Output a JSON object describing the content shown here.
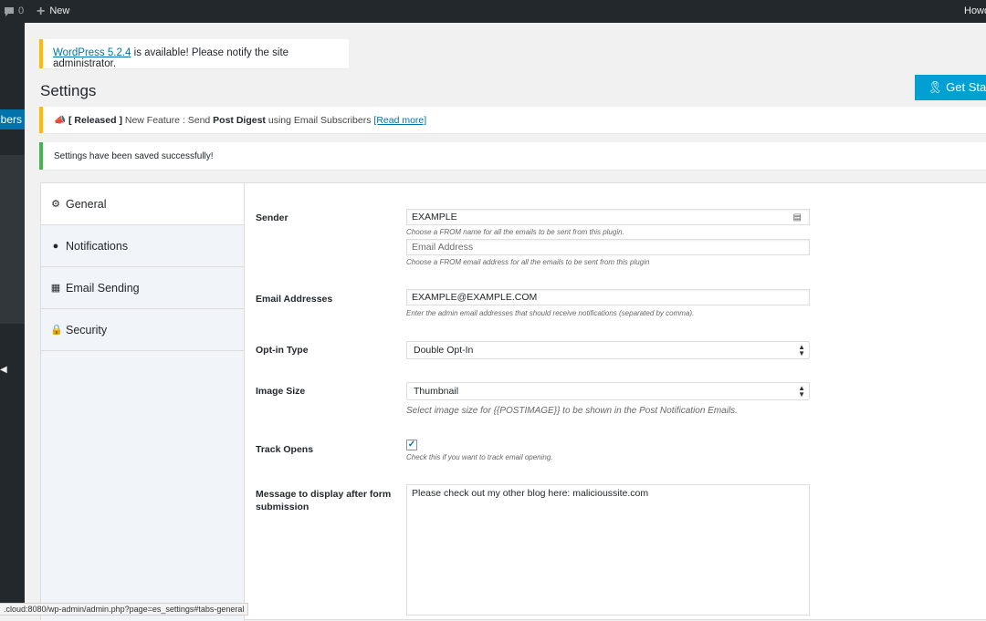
{
  "adminbar": {
    "comment_count": "0",
    "new_label": "New",
    "howdy": "Howdy"
  },
  "sidebar": {
    "active_label": "Email Subscribers"
  },
  "notices": {
    "update_link": "WordPress 5.2.4",
    "update_text": " is available! Please notify the site administrator.",
    "feature_released": "[ Released ]",
    "feature_text_1": " New Feature : Send ",
    "feature_bold": "Post Digest",
    "feature_text_2": " using Email Subscribers ",
    "feature_link": "[Read more]",
    "saved": "Settings have been saved successfully!"
  },
  "header": {
    "title": "Settings",
    "get_started": "Get Started"
  },
  "tabs": [
    {
      "label": "General",
      "icon": "gear-icon"
    },
    {
      "label": "Notifications",
      "icon": "group-icon"
    },
    {
      "label": "Email Sending",
      "icon": "table-icon"
    },
    {
      "label": "Security",
      "icon": "lock-icon"
    }
  ],
  "form": {
    "sender_label": "Sender",
    "sender_name_value": "EXAMPLE",
    "sender_name_help": "Choose a FROM name for all the emails to be sent from this plugin.",
    "sender_email_placeholder": "Email Address",
    "sender_email_help": "Choose a FROM email address for all the emails to be sent from this plugin",
    "email_addresses_label": "Email Addresses",
    "email_addresses_value": "EXAMPLE@EXAMPLE.COM",
    "email_addresses_help": "Enter the admin email addresses that should receive notifications (separated by comma).",
    "optin_label": "Opt-in Type",
    "optin_value": "Double Opt-In",
    "image_size_label": "Image Size",
    "image_size_value": "Thumbnail",
    "image_size_help": "Select image size for {{POSTIMAGE}} to be shown in the Post Notification Emails.",
    "track_opens_label": "Track Opens",
    "track_opens_checked": true,
    "track_opens_help": "Check this if you want to track email opening.",
    "message_label_1": "Message to display after form",
    "message_label_2": "submission",
    "message_value": "Please check out my other blog here: malicioussite.com"
  },
  "statusbar": {
    "url": ".cloud:8080/wp-admin/admin.php?page=es_settings#tabs-general"
  },
  "colors": {
    "accent": "#0073aa",
    "warning": "#ffb900",
    "success": "#46b450",
    "button": "#00a0d2"
  }
}
